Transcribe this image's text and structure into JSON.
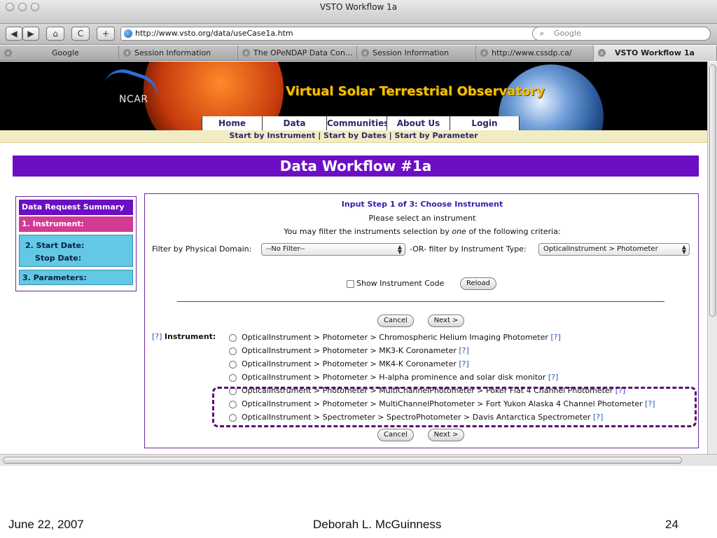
{
  "window": {
    "title": "VSTO Workflow 1a"
  },
  "toolbar": {
    "back": "◀",
    "forward": "▶",
    "home": "⌂",
    "reload": "C",
    "add": "+",
    "url": "http://www.vsto.org/data/useCase1a.htm",
    "search_placeholder": "Google"
  },
  "tabs": [
    {
      "label": "Google"
    },
    {
      "label": "Session Information"
    },
    {
      "label": "The OPeNDAP Data Con..."
    },
    {
      "label": "Session Information"
    },
    {
      "label": "http://www.cssdp.ca/"
    },
    {
      "label": "VSTO Workflow 1a"
    }
  ],
  "banner": {
    "ncar": "NCAR",
    "title": "Virtual Solar Terrestrial Observatory",
    "nav": [
      "Home",
      "Data",
      "Communities",
      "About Us",
      "Login"
    ],
    "subnav": "Start by Instrument | Start by Dates | Start by Parameter"
  },
  "workflow_title": "Data Workflow #1a",
  "sidebar": {
    "header": "Data Request Summary",
    "instrument": "1. Instrument:",
    "start_date": "2. Start Date:",
    "stop_date": "Stop Date:",
    "parameters": "3. Parameters:"
  },
  "main": {
    "step_title": "Input Step 1 of 3: Choose Instrument",
    "please": "Please select an instrument",
    "filter_desc_pre": "You may filter the instruments selection by ",
    "filter_desc_em": "one",
    "filter_desc_post": " of the following criteria:",
    "filter_domain_label": "Filter by Physical Domain:",
    "filter_domain_value": "--No Filter--",
    "or_label": "-OR- filter by Instrument Type:",
    "filter_type_value": "OpticalInstrument > Photometer",
    "show_code_label": "Show Instrument Code",
    "reload_label": "Reload",
    "cancel_label": "Cancel",
    "next_label": "Next >",
    "help_label": "[?]",
    "instrument_label": "Instrument:",
    "options": [
      "OpticalInstrument > Photometer > Chromospheric Helium Imaging Photometer",
      "OpticalInstrument > Photometer > MK3-K Coronameter",
      "OpticalInstrument > Photometer > MK4-K Coronameter",
      "OpticalInstrument > Photometer > H-alpha prominence and solar disk monitor",
      "OpticalInstrument > Photometer > MultiChannelPhotometer > Poker Flat 4 Channel Photometer",
      "OpticalInstrument > Photometer > MultiChannelPhotometer > Fort Yukon Alaska 4 Channel Photometer",
      "OpticalInstrument > Spectrometer > SpectroPhotometer > Davis Antarctica Spectrometer"
    ]
  },
  "footer": {
    "date": "June 22, 2007",
    "author": "Deborah L. McGuinness",
    "page": "24"
  }
}
